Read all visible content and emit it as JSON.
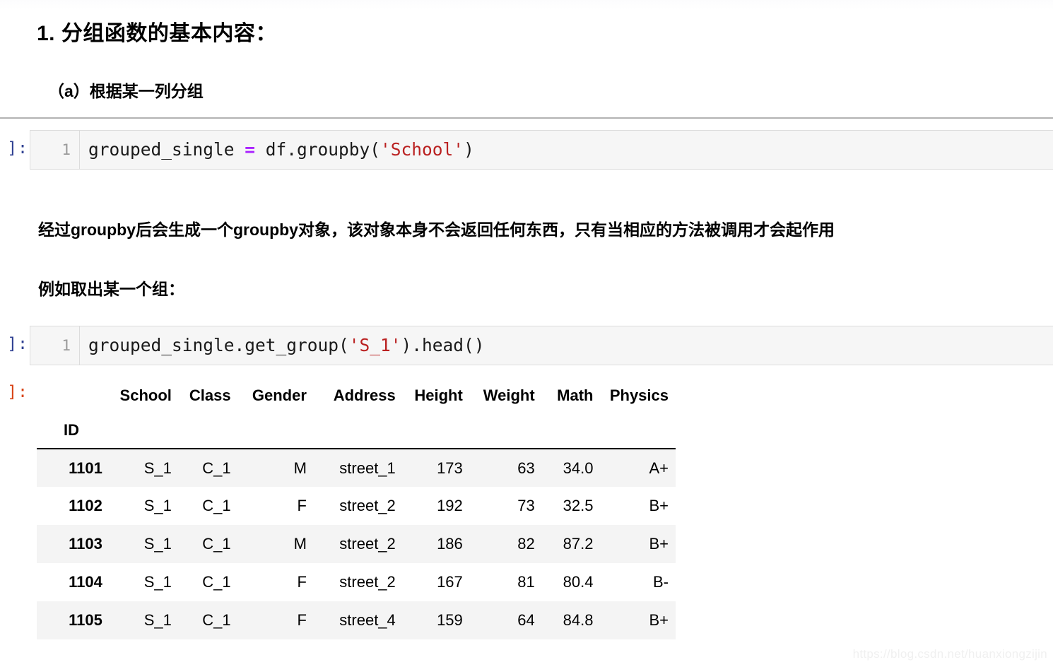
{
  "headings": {
    "h1": "1. 分组函数的基本内容：",
    "h2": "（a）根据某一列分组"
  },
  "paragraphs": {
    "groupby_note": "经过groupby后会生成一个groupby对象，该对象本身不会返回任何东西，只有当相应的方法被调用才会起作用",
    "example_note": "例如取出某一个组："
  },
  "cells": [
    {
      "prompt": "]:",
      "line_number": "1",
      "code_tokens": [
        {
          "text": "grouped_single ",
          "type": "plain"
        },
        {
          "text": "=",
          "type": "op"
        },
        {
          "text": " df.groupby(",
          "type": "plain"
        },
        {
          "text": "'School'",
          "type": "str"
        },
        {
          "text": ")",
          "type": "plain"
        }
      ],
      "code_plain": "grouped_single = df.groupby('School')"
    },
    {
      "prompt": "]:",
      "line_number": "1",
      "code_tokens": [
        {
          "text": "grouped_single.get_group(",
          "type": "plain"
        },
        {
          "text": "'S_1'",
          "type": "str"
        },
        {
          "text": ")",
          "type": "plain"
        },
        {
          "text": ".head()",
          "type": "plain"
        }
      ],
      "code_plain": "grouped_single.get_group('S_1').head()"
    }
  ],
  "output": {
    "prompt": "]:",
    "table": {
      "index_name": "ID",
      "columns": [
        "School",
        "Class",
        "Gender",
        "Address",
        "Height",
        "Weight",
        "Math",
        "Physics"
      ],
      "rows": [
        {
          "id": "1101",
          "values": [
            "S_1",
            "C_1",
            "M",
            "street_1",
            "173",
            "63",
            "34.0",
            "A+"
          ]
        },
        {
          "id": "1102",
          "values": [
            "S_1",
            "C_1",
            "F",
            "street_2",
            "192",
            "73",
            "32.5",
            "B+"
          ]
        },
        {
          "id": "1103",
          "values": [
            "S_1",
            "C_1",
            "M",
            "street_2",
            "186",
            "82",
            "87.2",
            "B+"
          ]
        },
        {
          "id": "1104",
          "values": [
            "S_1",
            "C_1",
            "F",
            "street_2",
            "167",
            "81",
            "80.4",
            "B-"
          ]
        },
        {
          "id": "1105",
          "values": [
            "S_1",
            "C_1",
            "F",
            "street_4",
            "159",
            "64",
            "84.8",
            "B+"
          ]
        }
      ]
    }
  },
  "watermark": "https://blog.csdn.net/huanxiongzijin",
  "colors": {
    "input_prompt": "#2e3f91",
    "output_prompt": "#d84315",
    "string_token": "#ba2121",
    "operator_token": "#aa22ff",
    "cell_background": "#f6f6f6",
    "row_stripe": "#f4f4f4",
    "rule": "#b3b3b3"
  }
}
